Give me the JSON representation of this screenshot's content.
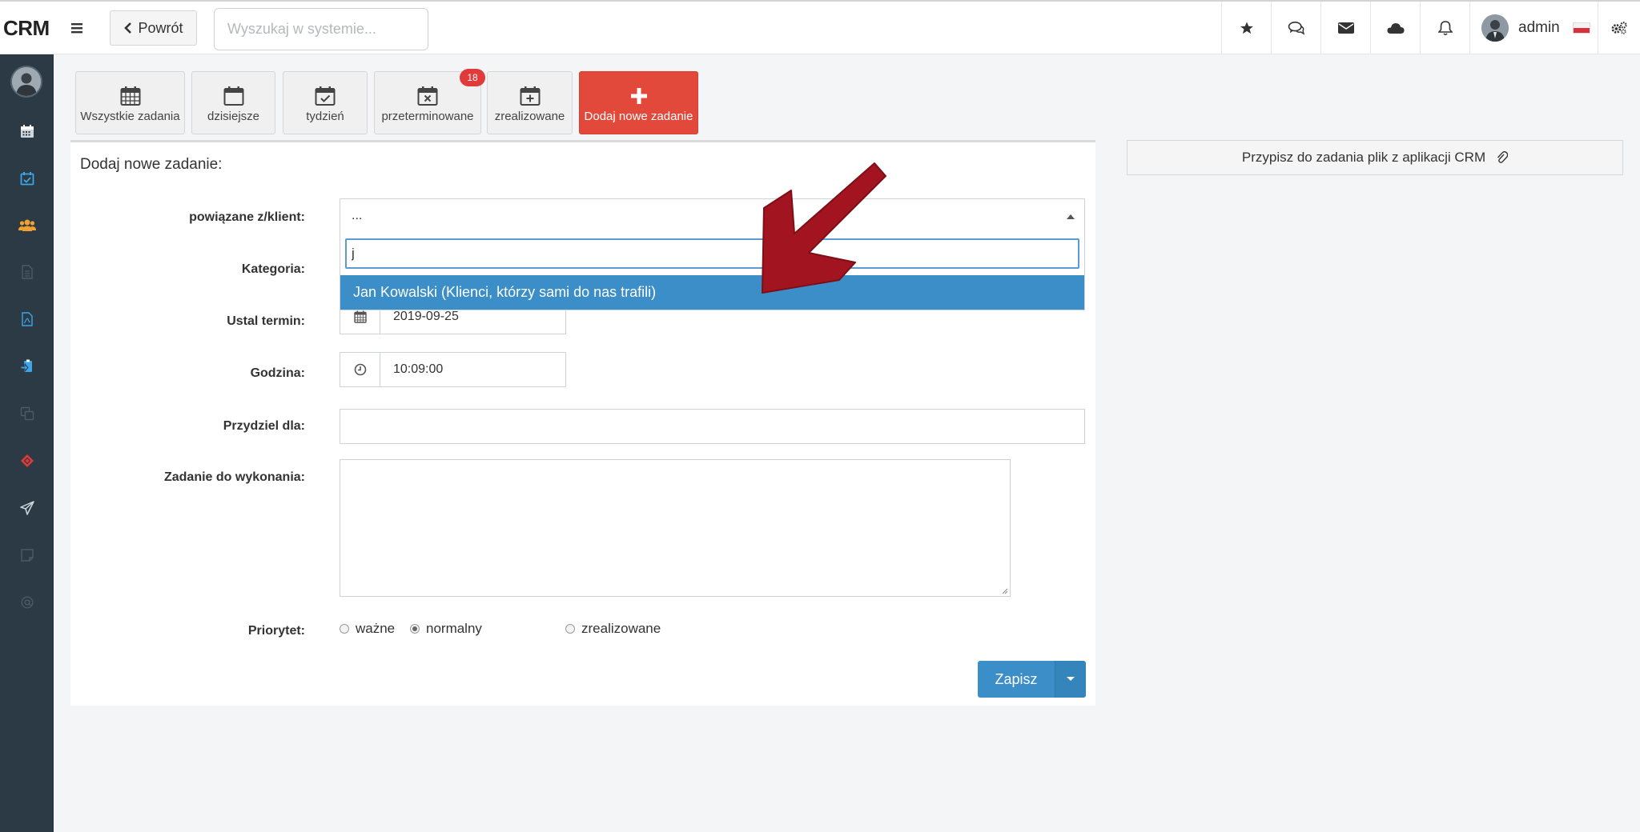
{
  "app": {
    "brand": "CRM"
  },
  "header": {
    "back_label": "Powrót",
    "search_placeholder": "Wyszukaj w systemie...",
    "user_name": "admin",
    "icons": [
      "star-icon",
      "comments-icon",
      "envelope-icon",
      "cloud-icon",
      "bell-icon",
      "cogs-icon"
    ]
  },
  "sidebar": {
    "items": [
      "calendar-icon",
      "calendar-check-icon",
      "users-icon",
      "file-icon",
      "pdf-file-icon",
      "clipboard-icon",
      "copy-icon",
      "ticket-icon",
      "paper-plane-icon",
      "sticky-note-icon",
      "at-icon"
    ]
  },
  "tabs": [
    {
      "label": "Wszystkie zadania",
      "icon": "calendar-grid-icon"
    },
    {
      "label": "dzisiejsze",
      "icon": "calendar-icon"
    },
    {
      "label": "tydzień",
      "icon": "calendar-check-icon"
    },
    {
      "label": "przeterminowane",
      "icon": "calendar-times-icon",
      "badge": "18"
    },
    {
      "label": "zrealizowane",
      "icon": "calendar-plus-icon"
    },
    {
      "label": "Dodaj nowe zadanie",
      "icon": "plus-icon"
    }
  ],
  "form": {
    "title": "Dodaj nowe zadanie:",
    "client_label": "powiązane z/klient:",
    "client_value": "...",
    "dropdown_search_value": "j",
    "dropdown_option": "Jan Kowalski (Klienci, którzy sami do nas trafili)",
    "category_label": "Kategoria:",
    "date_label": "Ustal termin:",
    "date_value": "2019-09-25",
    "time_label": "Godzina:",
    "time_value": "10:09:00",
    "assign_label": "Przydziel dla:",
    "task_label": "Zadanie do wykonania:",
    "priority_label": "Priorytet:",
    "priority_options": [
      "ważne",
      "normalny",
      "zrealizowane"
    ],
    "priority_selected": "normalny",
    "save_label": "Zapisz"
  },
  "attach_label": "Przypisz do zadania plik z aplikacji CRM",
  "colors": {
    "primary": "#3b8ec7",
    "danger": "#e3493a",
    "sidebar": "#2c3a45",
    "arrow": "#9e1220"
  }
}
